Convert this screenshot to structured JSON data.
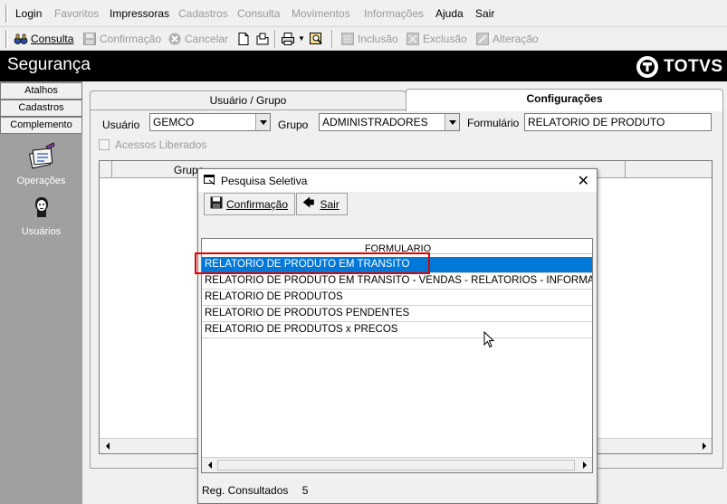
{
  "menu": {
    "items": [
      {
        "label": "Login",
        "enabled": true
      },
      {
        "label": "Favoritos",
        "enabled": false
      },
      {
        "label": "Impressoras",
        "enabled": true
      },
      {
        "label": "Cadastros",
        "enabled": false
      },
      {
        "label": "Consulta",
        "enabled": false
      },
      {
        "label": "Movimentos",
        "enabled": false
      },
      {
        "label": "Informações",
        "enabled": false
      },
      {
        "label": "Ajuda",
        "enabled": true
      },
      {
        "label": "Sair",
        "enabled": true
      }
    ]
  },
  "toolbar": {
    "consulta": "Consulta",
    "confirmacao": "Confirmação",
    "cancelar": "Cancelar",
    "inclusao": "Inclusão",
    "exclusao": "Exclusão",
    "alteracao": "Alteração"
  },
  "app": {
    "title": "Segurança",
    "brand": "TOTVS"
  },
  "sidebar": {
    "buttons": [
      "Atalhos",
      "Cadastros",
      "Complemento"
    ],
    "tools": [
      "Operações",
      "Usuários"
    ]
  },
  "tabs": {
    "usuario_grupo": "Usuário  / Grupo",
    "configuracoes": "Configurações"
  },
  "form": {
    "usuario_label": "Usuário",
    "usuario_value": "GEMCO",
    "grupo_label": "Grupo",
    "grupo_value": "ADMINISTRADORES",
    "formulario_label": "Formulário",
    "formulario_value": "RELATORIO DE PRODUTO",
    "acessos_label": "Acessos Liberados"
  },
  "grid": {
    "header_partial": "Grupo"
  },
  "dialog": {
    "title": "Pesquisa Seletiva",
    "confirm": "Confirmação",
    "exit": "Sair",
    "column": "FORMULARIO",
    "rows": [
      "RELATORIO DE PRODUTO EM TRANSITO",
      "RELATORIO DE PRODUTO EM TRANSITO - VENDAS - RELATORIOS - INFORMACOES",
      "RELATORIO DE PRODUTOS",
      "RELATORIO DE PRODUTOS PENDENTES",
      "RELATORIO DE PRODUTOS x PRECOS"
    ],
    "selected_index": 0,
    "status_label": "Reg. Consultados",
    "status_count": "5"
  },
  "colors": {
    "selection": "#0078d7",
    "highlight_box": "#e00000",
    "sidebar": "#a0a0a0",
    "titlebar": "#000000"
  }
}
